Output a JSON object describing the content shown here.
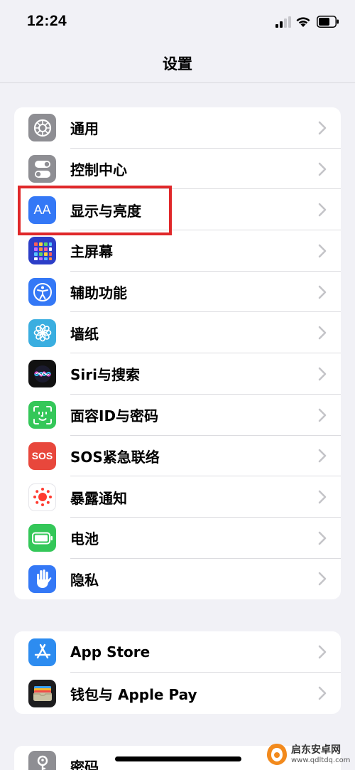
{
  "status_bar": {
    "time": "12:24"
  },
  "nav": {
    "title": "设置"
  },
  "groups": [
    {
      "items": [
        {
          "label": "通用",
          "icon": "gear-icon"
        },
        {
          "label": "控制中心",
          "icon": "toggle-icon"
        },
        {
          "label": "显示与亮度",
          "icon": "text-size-icon",
          "icon_text": "AA"
        },
        {
          "label": "主屏幕",
          "icon": "app-grid-icon"
        },
        {
          "label": "辅助功能",
          "icon": "accessibility-icon"
        },
        {
          "label": "墙纸",
          "icon": "flower-icon"
        },
        {
          "label": "Siri与搜索",
          "icon": "siri-icon"
        },
        {
          "label": "面容ID与密码",
          "icon": "face-id-icon"
        },
        {
          "label": "SOS紧急联络",
          "icon": "sos-icon",
          "icon_text": "SOS"
        },
        {
          "label": "暴露通知",
          "icon": "exposure-icon"
        },
        {
          "label": "电池",
          "icon": "battery-icon"
        },
        {
          "label": "隐私",
          "icon": "hand-icon"
        }
      ]
    },
    {
      "items": [
        {
          "label": "App Store",
          "icon": "app-store-icon"
        },
        {
          "label": "钱包与 Apple Pay",
          "icon": "wallet-icon"
        }
      ]
    },
    {
      "items": [
        {
          "label": "密码",
          "icon": "key-icon"
        }
      ]
    }
  ],
  "colors": {
    "highlight": "#e0282a",
    "gray_icon": "#8e8e93",
    "blue_icon": "#3478f6",
    "green_icon": "#34c759",
    "red_icon": "#e8473c"
  },
  "watermark": {
    "text": "启东安卓网",
    "url": "www.qdltdq.com"
  }
}
